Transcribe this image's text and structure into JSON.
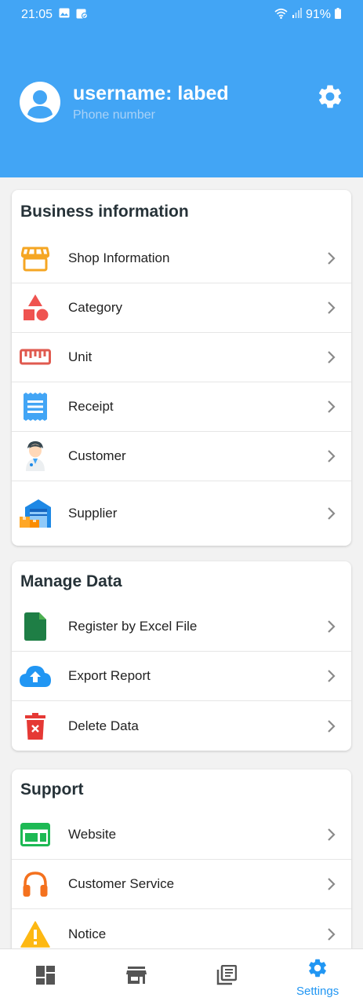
{
  "status": {
    "time": "21:05",
    "battery": "91%"
  },
  "profile": {
    "username": "username: labed",
    "phone_placeholder": "Phone number"
  },
  "sections": [
    {
      "title": "Business information",
      "items": [
        {
          "label": "Shop Information",
          "icon": "shop-icon"
        },
        {
          "label": "Category",
          "icon": "shapes-icon"
        },
        {
          "label": "Unit",
          "icon": "ruler-icon"
        },
        {
          "label": "Receipt",
          "icon": "receipt-icon"
        },
        {
          "label": "Customer",
          "icon": "customer-icon"
        },
        {
          "label": "Supplier",
          "icon": "warehouse-icon"
        }
      ]
    },
    {
      "title": "Manage Data",
      "items": [
        {
          "label": "Register by Excel File",
          "icon": "excel-file-icon"
        },
        {
          "label": "Export Report",
          "icon": "cloud-upload-icon"
        },
        {
          "label": "Delete Data",
          "icon": "trash-icon"
        }
      ]
    },
    {
      "title": "Support",
      "items": [
        {
          "label": "Website",
          "icon": "website-icon"
        },
        {
          "label": "Customer Service",
          "icon": "headphones-icon"
        },
        {
          "label": "Notice",
          "icon": "warning-icon"
        }
      ]
    }
  ],
  "nav": {
    "settings_label": "Settings"
  },
  "colors": {
    "header": "#42a5f5",
    "accent": "#2196f3"
  }
}
